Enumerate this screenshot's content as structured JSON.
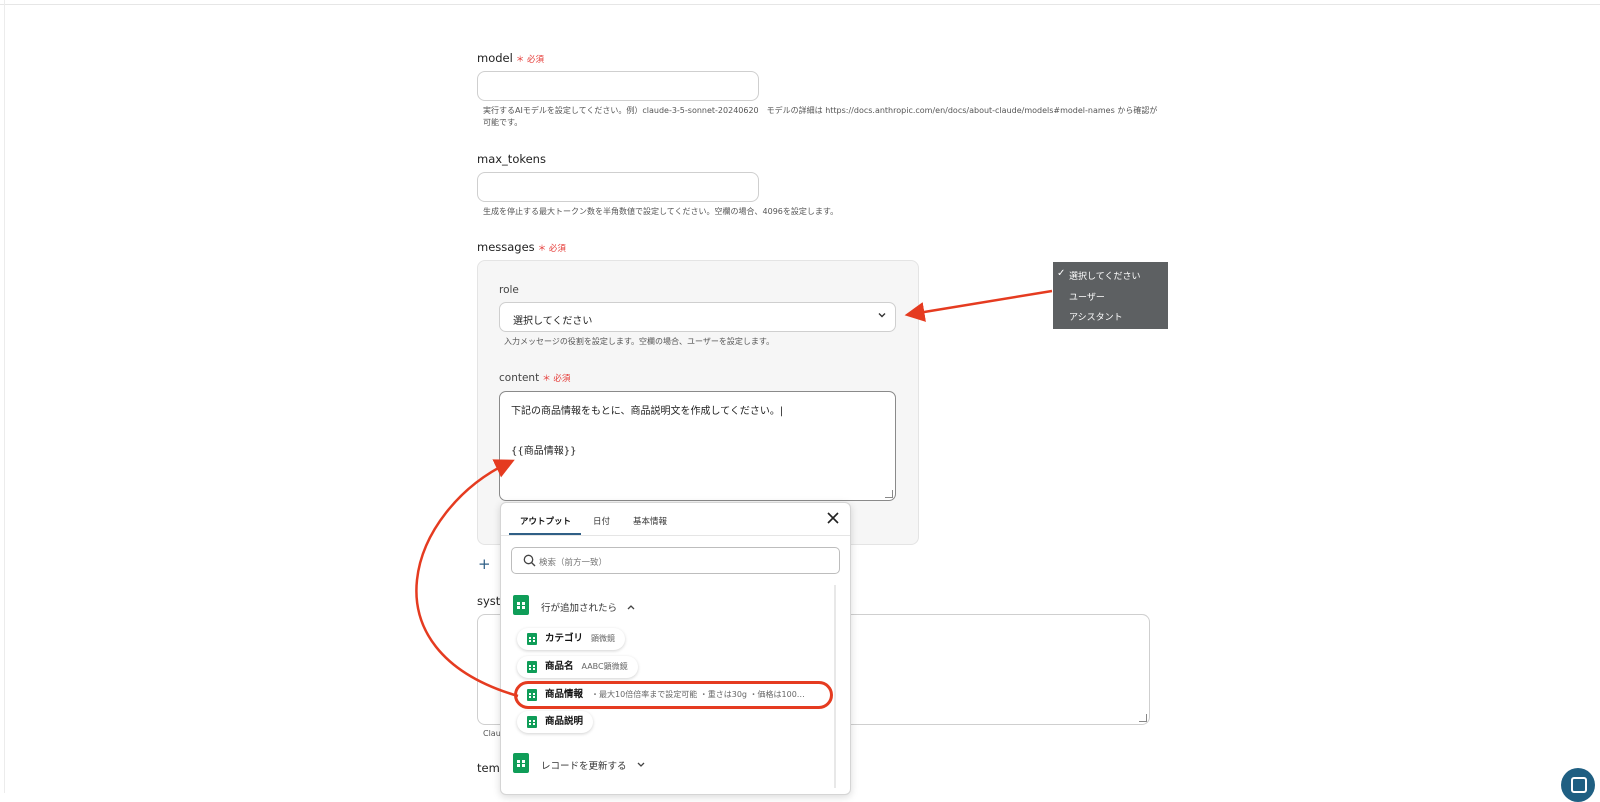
{
  "fields": {
    "model": {
      "label": "model",
      "required": "＊ 必須",
      "help_line1": "実行するAIモデルを設定してください。例）claude-3-5-sonnet-20240620　モデルの詳細は https://docs.anthropic.com/en/docs/about-claude/models#model-names から確認が",
      "help_line2": "可能です。"
    },
    "max_tokens": {
      "label": "max_tokens",
      "help": "生成を停止する最大トークン数を半角数値で設定してください。空欄の場合、4096を設定します。"
    },
    "messages": {
      "label": "messages",
      "required": "＊ 必須"
    },
    "role": {
      "label": "role",
      "value": "選択してください",
      "help": "入力メッセージの役割を設定します。空欄の場合、ユーザーを設定します。"
    },
    "content": {
      "label": "content",
      "required": "＊ 必須",
      "line1": "下記の商品情報をもとに、商品説明文を作成してください。|",
      "line2": "{{商品情報}}"
    },
    "system": {
      "label_partial": "syst",
      "help_partial": "Clau"
    },
    "temperature": {
      "label_partial": "temp"
    }
  },
  "role_dropdown": {
    "options": [
      "選択してください",
      "ユーザー",
      "アシスタント"
    ],
    "selected": "選択してください",
    "check_icon": "checkmark-icon"
  },
  "popup": {
    "tabs": [
      "アウトプット",
      "日付",
      "基本情報"
    ],
    "active_tab": "アウトプット",
    "search_placeholder": "検索（前方一致）",
    "groups": [
      {
        "title": "行が追加されたら",
        "expanded": true,
        "items": [
          {
            "key": "カテゴリ",
            "value": "顕微鏡"
          },
          {
            "key": "商品名",
            "value": "AABC顕微鏡"
          },
          {
            "key": "商品情報",
            "value": "・最大10倍倍率まで設定可能 ・重さは30g ・価格は100…"
          },
          {
            "key": "商品説明",
            "value": ""
          }
        ]
      },
      {
        "title": "レコードを更新する",
        "expanded": false
      }
    ]
  },
  "colors": {
    "required": "#e53935",
    "annotation": "#e53b20",
    "sheets_green": "#0f9d58",
    "dropdown_bg": "#5d6062",
    "accent": "#2f5f86"
  }
}
